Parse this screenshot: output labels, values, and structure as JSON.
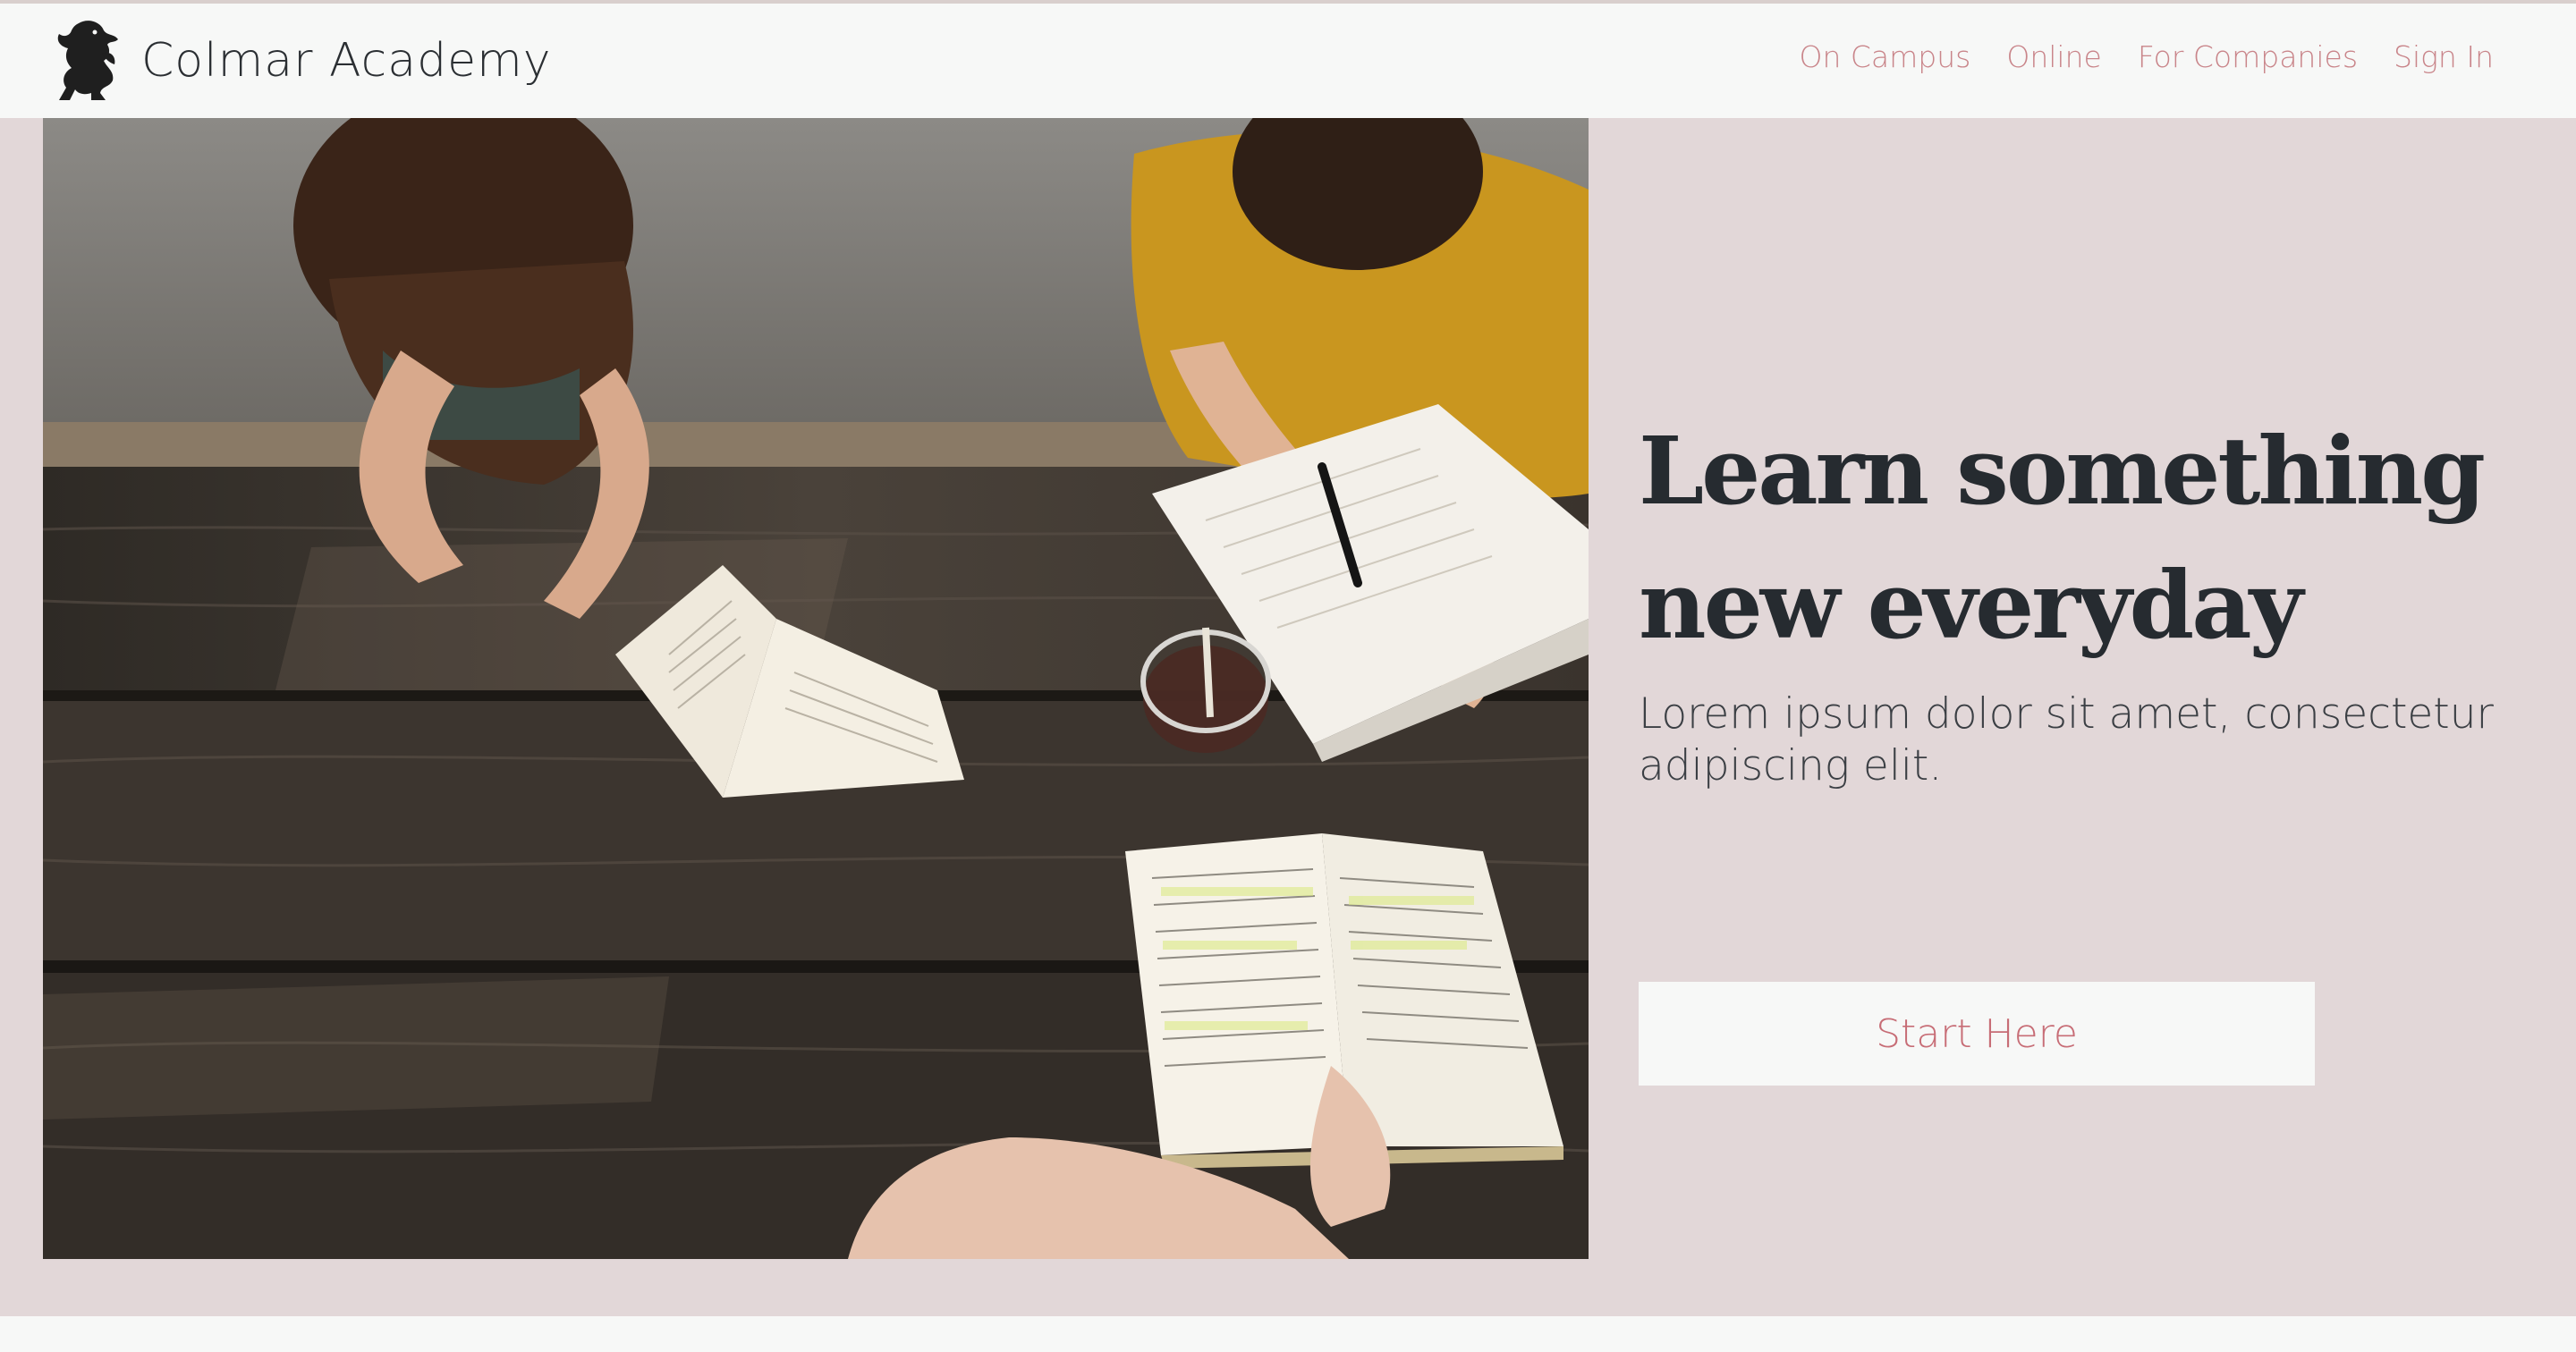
{
  "brand": {
    "name": "Colmar Academy",
    "logo_icon": "lion-rampant-icon"
  },
  "nav": {
    "links": [
      {
        "label": "On Campus"
      },
      {
        "label": "Online"
      },
      {
        "label": "For Companies"
      },
      {
        "label": "Sign In"
      }
    ]
  },
  "hero": {
    "image_description_icon": "students-reading-photo",
    "title": "Learn something new everyday",
    "subtitle": "Lorem ipsum dolor sit amet, consectetur adipiscing elit.",
    "cta_label": "Start Here"
  },
  "colors": {
    "accent": "#c9858a",
    "hero_background": "#e2d7d8",
    "navbar_background": "#f7f8f7",
    "title_text": "#262b30"
  }
}
